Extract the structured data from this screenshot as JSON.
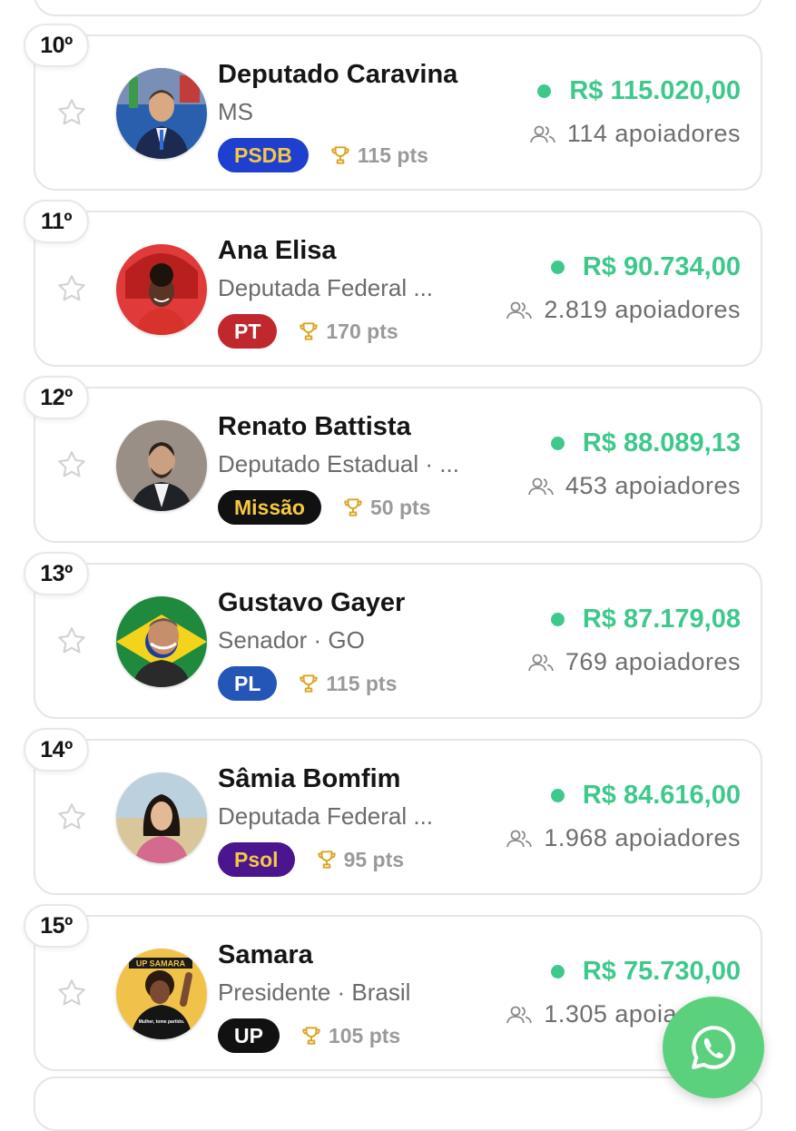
{
  "entries": [
    {
      "rank": "10º",
      "name": "Deputado Caravina",
      "subtitle": "MS",
      "party": "PSDB",
      "party_bg": "#1f3fd0",
      "party_fg": "#f5c842",
      "points": "115 pts",
      "amount": "R$ 115.020,00",
      "supporters": "114 apoiadores"
    },
    {
      "rank": "11º",
      "name": "Ana Elisa",
      "subtitle": "Deputada Federal ...",
      "party": "PT",
      "party_bg": "#c0282d",
      "party_fg": "#ffffff",
      "points": "170 pts",
      "amount": "R$ 90.734,00",
      "supporters": "2.819 apoiadores"
    },
    {
      "rank": "12º",
      "name": "Renato Battista",
      "subtitle": "Deputado Estadual · ...",
      "party": "Missão",
      "party_bg": "#111111",
      "party_fg": "#f5c842",
      "points": "50 pts",
      "amount": "R$ 88.089,13",
      "supporters": "453 apoiadores"
    },
    {
      "rank": "13º",
      "name": "Gustavo Gayer",
      "subtitle": "Senador · GO",
      "party": "PL",
      "party_bg": "#2456b8",
      "party_fg": "#ffffff",
      "points": "115 pts",
      "amount": "R$ 87.179,08",
      "supporters": "769 apoiadores"
    },
    {
      "rank": "14º",
      "name": "Sâmia Bomfim",
      "subtitle": "Deputada Federal ...",
      "party": "Psol",
      "party_bg": "#4b1590",
      "party_fg": "#f5c842",
      "points": "95 pts",
      "amount": "R$ 84.616,00",
      "supporters": "1.968 apoiadores"
    },
    {
      "rank": "15º",
      "name": "Samara",
      "subtitle": "Presidente · Brasil",
      "party": "UP",
      "party_bg": "#111111",
      "party_fg": "#ffffff",
      "points": "105 pts",
      "amount": "R$ 75.730,00",
      "supporters": "1.305 apoiadores"
    }
  ],
  "avatar_15": {
    "banner": "UP SAMARA",
    "shirt": "Mulher, tome partido."
  },
  "colors": {
    "accent_green": "#3ec98b",
    "whatsapp": "#5bd07d",
    "trophy": "#d9a520"
  },
  "icons": {
    "favorite": "star-outline-icon",
    "points": "trophy-icon",
    "supporters": "users-icon",
    "fab": "whatsapp-icon"
  }
}
